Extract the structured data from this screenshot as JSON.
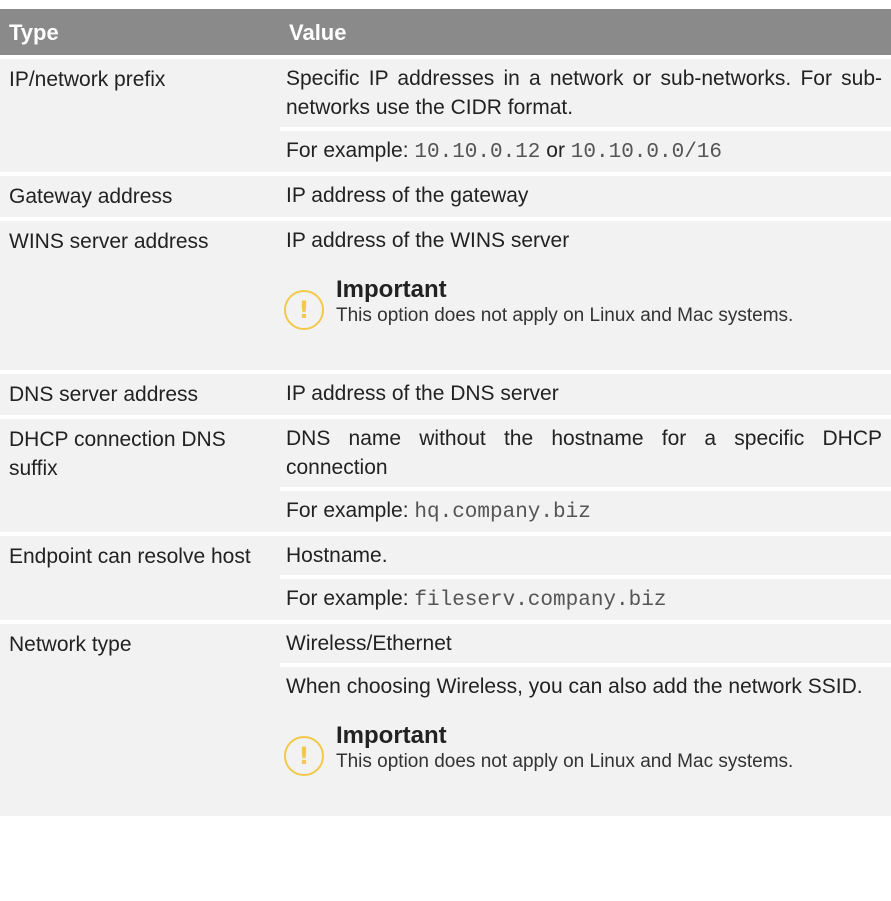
{
  "table": {
    "headers": {
      "type": "Type",
      "value": "Value"
    },
    "rows": [
      {
        "type": "IP/network prefix",
        "line1": "Specific IP addresses in a network or sub-networks. For sub-networks use the CIDR format.",
        "example_label": "For example:",
        "example_code1": "10.10.0.12",
        "example_or": "or",
        "example_code2": "10.10.0.0/16"
      },
      {
        "type": "Gateway address",
        "line1": "IP address of the gateway"
      },
      {
        "type": "WINS server address",
        "line1": "IP address of the WINS server",
        "callout_title": "Important",
        "callout_text": "This option does not apply on Linux and Mac systems."
      },
      {
        "type": "DNS server address",
        "line1": "IP address of the DNS server"
      },
      {
        "type": "DHCP connection DNS suffix",
        "line1": "DNS name without the hostname for a specific DHCP connection",
        "example_label": "For example:",
        "example_code1": "hq.company.biz"
      },
      {
        "type": "Endpoint can resolve host",
        "line1": "Hostname.",
        "example_label": "For example:",
        "example_code1": "fileserv.company.biz"
      },
      {
        "type": "Network type",
        "line1": "Wireless/Ethernet",
        "line2": "When choosing Wireless, you can also add the network SSID.",
        "callout_title": "Important",
        "callout_text": "This option does not apply on Linux and Mac systems."
      }
    ]
  },
  "icons": {
    "callout": "exclamation-icon"
  },
  "colors": {
    "header_bg": "#8a8a8a",
    "row_bg": "#f2f2f2",
    "callout_accent": "#f2c94c"
  }
}
